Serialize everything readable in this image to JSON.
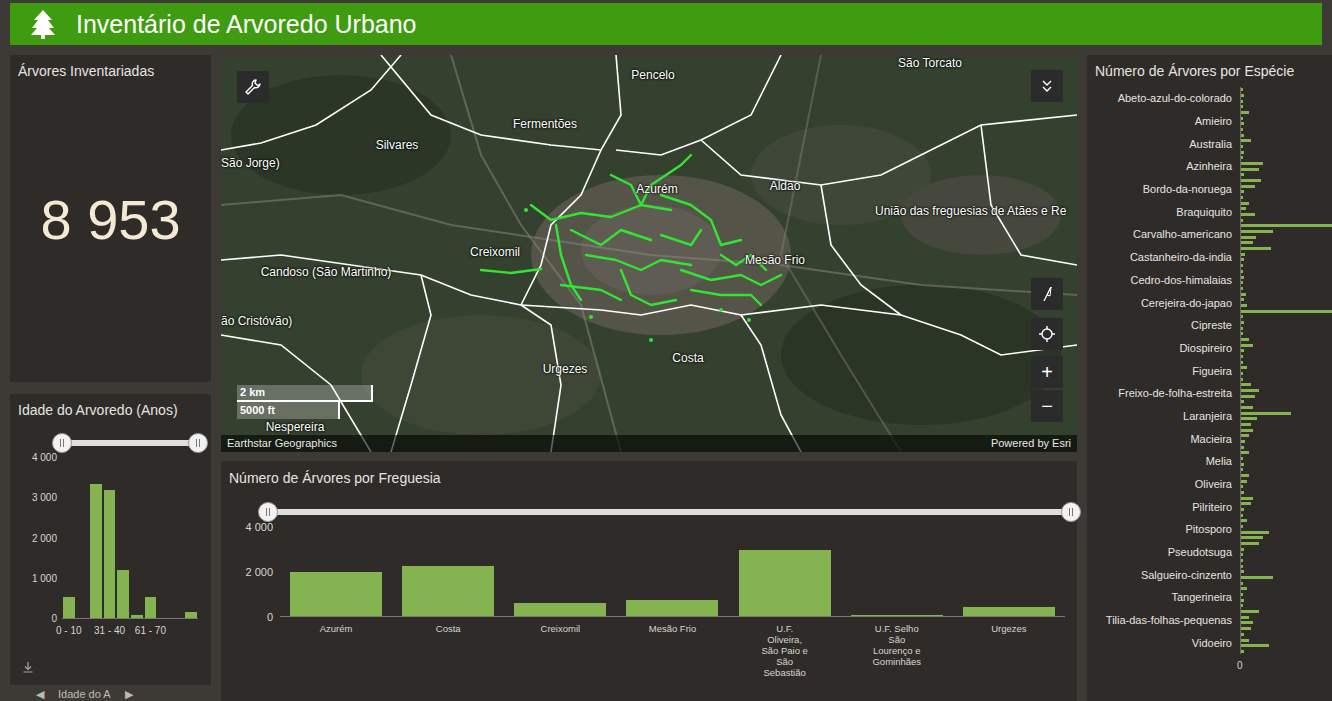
{
  "header": {
    "title": "Inventário de Arvoredo Urbano"
  },
  "total_panel": {
    "title": "Árvores Inventariadas",
    "value": "8 953"
  },
  "age_panel": {
    "title": "Idade do Arvoredo (Anos)",
    "range": {
      "low": 0,
      "high": 1
    },
    "y_ticks": [
      "4 000",
      "3 000",
      "2 000",
      "1 000",
      "0"
    ],
    "x_labels": [
      {
        "text": "0 - 10",
        "bin": 0
      },
      {
        "text": "31 - 40",
        "bin": 3
      },
      {
        "text": "61 - 70",
        "bin": 6
      }
    ],
    "values": [
      520,
      0,
      3330,
      3180,
      1200,
      80,
      520,
      0,
      0,
      150
    ],
    "footer": {
      "prev": "◀",
      "label": "Idade do A",
      "next": "▶"
    }
  },
  "map": {
    "labels": [
      "Pencelo",
      "São Torcato",
      "Fermentões",
      "Silvares",
      "São Jorge)",
      "Azurém",
      "Aldão",
      "União das freguesias de Atães e Re",
      "Creixomil",
      "Mesão Frio",
      "Candoso (São Martinho)",
      "ão Cristóvão)",
      "Urgezes",
      "Costa",
      "Nespereira"
    ],
    "scale": [
      "2 km",
      "5000 ft"
    ],
    "attribution": "Earthstar Geographics",
    "powered_by": "Powered by Esri",
    "zoom_in": "+",
    "zoom_out": "−"
  },
  "parish_panel": {
    "title": "Número de Árvores por Freguesia",
    "range": {
      "low": 0,
      "high": 1
    },
    "y_ticks": [
      "4 000",
      "2 000",
      "0"
    ],
    "bars": [
      {
        "label": "Azurém",
        "value": 1955
      },
      {
        "label": "Costa",
        "value": 2222
      },
      {
        "label": "Creixomil",
        "value": 578
      },
      {
        "label": "Mesão Frio",
        "value": 711
      },
      {
        "label": "U.F. Oliveira, São Paio e São Sebastião",
        "value": 2933
      },
      {
        "label": "U.F. Selho São Lourenço e Gominhães",
        "value": 44
      },
      {
        "label": "Urgezes",
        "value": 400
      }
    ]
  },
  "species_panel": {
    "title": "Número de Árvores por Espécie",
    "x_ticks": [
      "0"
    ],
    "groups": [
      {
        "label": "Abeto-azul-do-colorado",
        "values": [
          10,
          15,
          10,
          10
        ]
      },
      {
        "label": "Amieiro",
        "values": [
          40,
          10,
          15,
          10
        ]
      },
      {
        "label": "Australia",
        "values": [
          15,
          50,
          10,
          15
        ]
      },
      {
        "label": "Azinheira",
        "values": [
          10,
          110,
          90,
          15
        ]
      },
      {
        "label": "Bordo-da-noruega",
        "values": [
          100,
          70,
          15,
          10
        ]
      },
      {
        "label": "Braquiquito",
        "values": [
          40,
          25,
          70,
          10
        ]
      },
      {
        "label": "Carvalho-americano",
        "values": [
          475,
          160,
          75,
          60
        ]
      },
      {
        "label": "Castanheiro-da-india",
        "values": [
          150,
          20,
          15,
          10
        ]
      },
      {
        "label": "Cedro-dos-himalaias",
        "values": [
          10,
          15,
          10,
          10
        ]
      },
      {
        "label": "Cerejeira-do-japao",
        "values": [
          25,
          15,
          30,
          475
        ]
      },
      {
        "label": "Cipreste",
        "values": [
          10,
          15,
          10,
          10
        ]
      },
      {
        "label": "Diospireiro",
        "values": [
          40,
          60,
          15,
          10
        ]
      },
      {
        "label": "Figueira",
        "values": [
          10,
          30,
          10,
          10
        ]
      },
      {
        "label": "Freixo-de-folha-estreita",
        "values": [
          50,
          90,
          70,
          15
        ]
      },
      {
        "label": "Laranjeira",
        "values": [
          60,
          250,
          80,
          50
        ]
      },
      {
        "label": "Macieira",
        "values": [
          60,
          40,
          20,
          15
        ]
      },
      {
        "label": "Melia",
        "values": [
          40,
          10,
          15,
          10
        ]
      },
      {
        "label": "Oliveira",
        "values": [
          40,
          30,
          10,
          15
        ]
      },
      {
        "label": "Pilriteiro",
        "values": [
          60,
          50,
          15,
          10
        ]
      },
      {
        "label": "Pitosporo",
        "values": [
          30,
          10,
          140,
          110
        ]
      },
      {
        "label": "Pseudotsuga",
        "values": [
          90,
          15,
          10,
          10
        ]
      },
      {
        "label": "Salgueiro-cinzento",
        "values": [
          10,
          15,
          160,
          10
        ]
      },
      {
        "label": "Tangerineira",
        "values": [
          30,
          10,
          15,
          10
        ]
      },
      {
        "label": "Tilia-das-folhas-pequenas",
        "values": [
          90,
          40,
          60,
          50
        ]
      },
      {
        "label": "Vidoeiro",
        "values": [
          15,
          40,
          140,
          15
        ]
      }
    ]
  }
}
